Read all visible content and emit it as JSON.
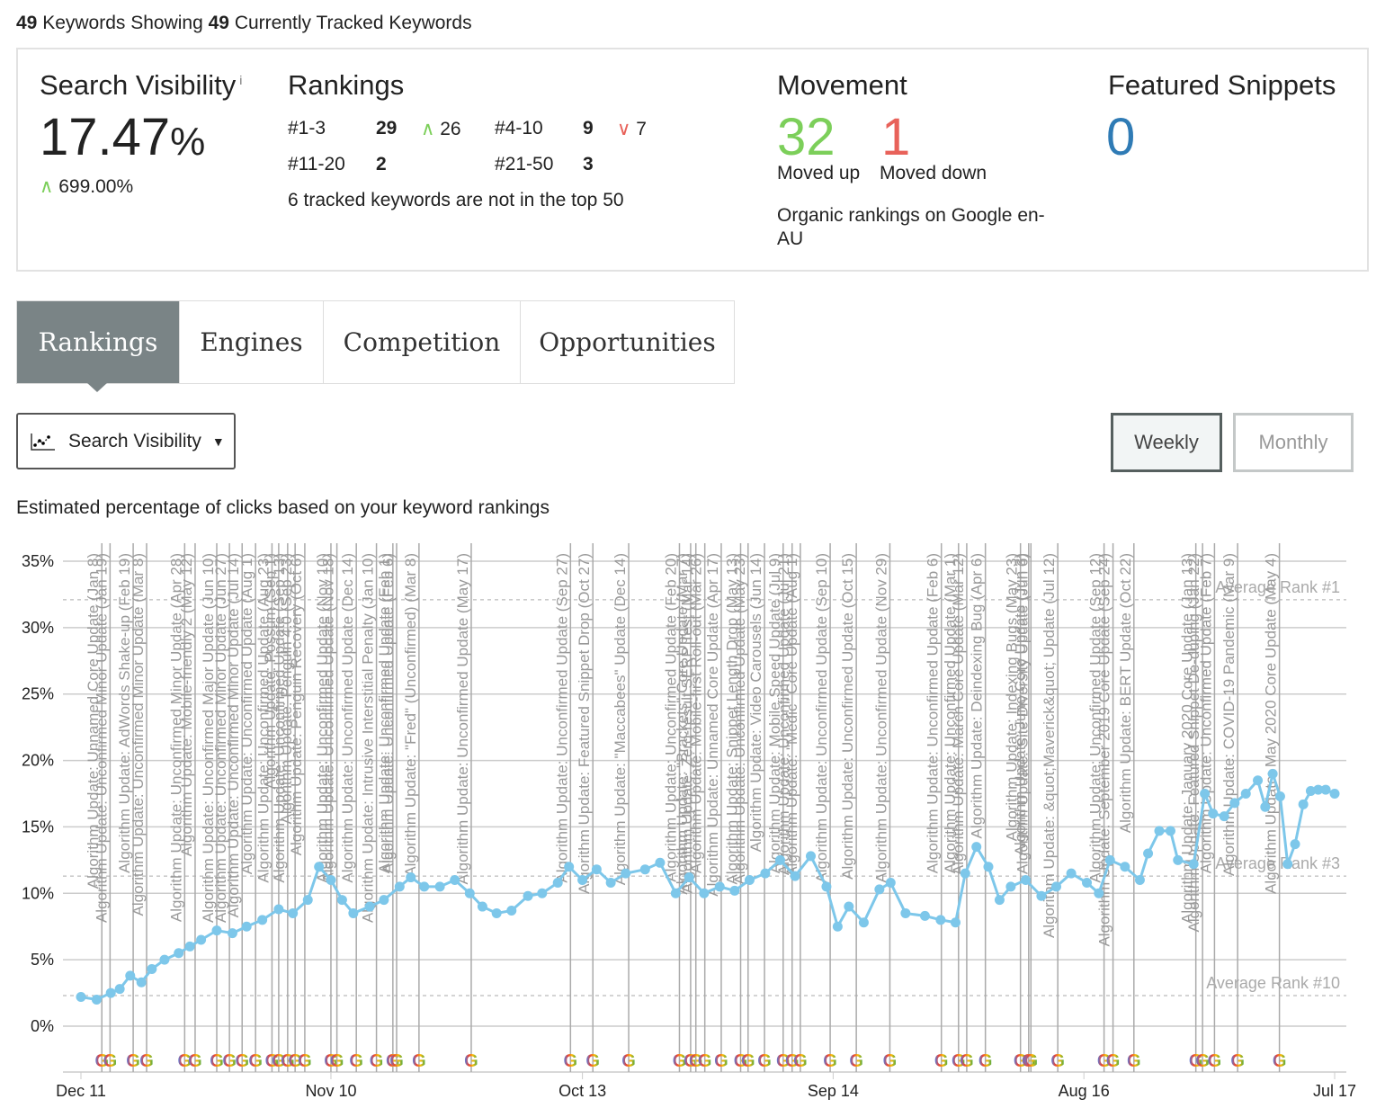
{
  "header": {
    "count1": "49",
    "text1": " Keywords Showing ",
    "count2": "49",
    "text2": " Currently Tracked Keywords"
  },
  "summary": {
    "visibility": {
      "title": "Search Visibility",
      "info": "i",
      "value": "17.47",
      "unit": "%",
      "change": "699.00%"
    },
    "rankings": {
      "title": "Rankings",
      "rows": [
        {
          "label": "#1-3",
          "count": "29",
          "change": "26",
          "direction": "up"
        },
        {
          "label": "#4-10",
          "count": "9",
          "change": "7",
          "direction": "down"
        },
        {
          "label": "#11-20",
          "count": "2"
        },
        {
          "label": "#21-50",
          "count": "3"
        }
      ],
      "note": "6 tracked keywords are not in the top 50"
    },
    "movement": {
      "title": "Movement",
      "up": "32",
      "up_label": "Moved up",
      "down": "1",
      "down_label": "Moved down",
      "note": "Organic rankings on Google en-AU"
    },
    "snippets": {
      "title": "Featured Snippets",
      "value": "0"
    }
  },
  "tabs": [
    {
      "label": "Rankings",
      "active": true
    },
    {
      "label": "Engines"
    },
    {
      "label": "Competition"
    },
    {
      "label": "Opportunities"
    }
  ],
  "controls": {
    "metric": "Search Visibility",
    "metric_icon": "line-chart-icon",
    "weekly": "Weekly",
    "monthly": "Monthly",
    "selected": "Weekly"
  },
  "subtitle": "Estimated percentage of clicks based on your keyword rankings",
  "colors": {
    "series": "#7dc7ea",
    "up": "#7ccf5a",
    "down": "#e8625a",
    "snippets": "#2f7bb5",
    "active_tab": "#7a8486"
  },
  "chart_data": {
    "type": "line",
    "ylim": [
      0,
      35
    ],
    "yticks": [
      "0%",
      "5%",
      "10%",
      "15%",
      "20%",
      "25%",
      "30%",
      "35%"
    ],
    "xticks": [
      {
        "date": "2015-12-11",
        "label": "Dec 11"
      },
      {
        "date": "2016-11-10",
        "label": "Nov 10"
      },
      {
        "date": "2017-10-13",
        "label": "Oct 13"
      },
      {
        "date": "2018-09-14",
        "label": "Sep 14"
      },
      {
        "date": "2019-08-16",
        "label": "Aug 16"
      },
      {
        "date": "2020-07-17",
        "label": "Jul 17"
      }
    ],
    "xrange": [
      "2015-12-11",
      "2020-07-17"
    ],
    "grid": true,
    "reference_lines": [
      {
        "value": 32.1,
        "label": "Average Rank #1"
      },
      {
        "value": 11.3,
        "label": "Average Rank #3"
      },
      {
        "value": 2.3,
        "label": "Average Rank #10"
      }
    ],
    "series": [
      {
        "points": [
          [
            "2015-12-11",
            2.2
          ],
          [
            "2016-01-01",
            2.0
          ],
          [
            "2016-01-20",
            2.5
          ],
          [
            "2016-02-01",
            2.8
          ],
          [
            "2016-02-15",
            3.8
          ],
          [
            "2016-03-01",
            3.3
          ],
          [
            "2016-03-15",
            4.3
          ],
          [
            "2016-04-01",
            5.0
          ],
          [
            "2016-04-20",
            5.5
          ],
          [
            "2016-05-05",
            6.0
          ],
          [
            "2016-05-20",
            6.5
          ],
          [
            "2016-06-10",
            7.2
          ],
          [
            "2016-07-01",
            7.0
          ],
          [
            "2016-07-20",
            7.5
          ],
          [
            "2016-08-10",
            8.0
          ],
          [
            "2016-09-01",
            8.8
          ],
          [
            "2016-09-20",
            8.5
          ],
          [
            "2016-10-10",
            9.5
          ],
          [
            "2016-10-25",
            12.0
          ],
          [
            "2016-11-10",
            11.0
          ],
          [
            "2016-11-25",
            9.5
          ],
          [
            "2016-12-10",
            8.5
          ],
          [
            "2017-01-01",
            9.0
          ],
          [
            "2017-01-20",
            9.5
          ],
          [
            "2017-02-10",
            10.5
          ],
          [
            "2017-02-25",
            11.2
          ],
          [
            "2017-03-15",
            10.5
          ],
          [
            "2017-04-05",
            10.5
          ],
          [
            "2017-04-25",
            11.0
          ],
          [
            "2017-05-15",
            10.0
          ],
          [
            "2017-06-01",
            9.0
          ],
          [
            "2017-06-20",
            8.5
          ],
          [
            "2017-07-10",
            8.7
          ],
          [
            "2017-08-01",
            9.8
          ],
          [
            "2017-08-20",
            10.0
          ],
          [
            "2017-09-10",
            10.8
          ],
          [
            "2017-09-25",
            12.0
          ],
          [
            "2017-10-13",
            11.0
          ],
          [
            "2017-11-01",
            11.8
          ],
          [
            "2017-11-20",
            10.8
          ],
          [
            "2017-12-10",
            11.5
          ],
          [
            "2018-01-05",
            11.8
          ],
          [
            "2018-01-25",
            12.3
          ],
          [
            "2018-02-15",
            10.0
          ],
          [
            "2018-03-05",
            11.2
          ],
          [
            "2018-03-25",
            10.0
          ],
          [
            "2018-04-15",
            10.5
          ],
          [
            "2018-05-05",
            10.2
          ],
          [
            "2018-05-25",
            11.0
          ],
          [
            "2018-06-15",
            11.5
          ],
          [
            "2018-07-05",
            12.5
          ],
          [
            "2018-07-25",
            11.3
          ],
          [
            "2018-08-15",
            12.8
          ],
          [
            "2018-09-05",
            10.5
          ],
          [
            "2018-09-20",
            7.5
          ],
          [
            "2018-10-05",
            9.0
          ],
          [
            "2018-10-25",
            7.8
          ],
          [
            "2018-11-15",
            10.3
          ],
          [
            "2018-11-30",
            10.8
          ],
          [
            "2018-12-20",
            8.5
          ],
          [
            "2019-01-15",
            8.3
          ],
          [
            "2019-02-05",
            8.0
          ],
          [
            "2019-02-25",
            7.8
          ],
          [
            "2019-03-10",
            11.5
          ],
          [
            "2019-03-25",
            13.5
          ],
          [
            "2019-04-10",
            12.0
          ],
          [
            "2019-04-25",
            9.5
          ],
          [
            "2019-05-10",
            10.5
          ],
          [
            "2019-05-30",
            11.0
          ],
          [
            "2019-06-20",
            9.8
          ],
          [
            "2019-07-10",
            10.5
          ],
          [
            "2019-07-30",
            11.5
          ],
          [
            "2019-08-20",
            10.8
          ],
          [
            "2019-09-05",
            10.0
          ],
          [
            "2019-09-20",
            12.5
          ],
          [
            "2019-10-10",
            12.0
          ],
          [
            "2019-10-30",
            11.0
          ],
          [
            "2019-11-10",
            13.0
          ],
          [
            "2019-11-25",
            14.7
          ],
          [
            "2019-12-10",
            14.7
          ],
          [
            "2019-12-20",
            12.5
          ],
          [
            "2020-01-10",
            12.2
          ],
          [
            "2020-01-25",
            17.5
          ],
          [
            "2020-02-05",
            16.0
          ],
          [
            "2020-02-20",
            15.8
          ],
          [
            "2020-03-05",
            16.8
          ],
          [
            "2020-03-20",
            17.5
          ],
          [
            "2020-04-05",
            18.5
          ],
          [
            "2020-04-15",
            16.5
          ],
          [
            "2020-04-25",
            19.0
          ],
          [
            "2020-05-05",
            17.3
          ],
          [
            "2020-05-15",
            12.2
          ],
          [
            "2020-05-25",
            13.7
          ],
          [
            "2020-06-05",
            16.7
          ],
          [
            "2020-06-15",
            17.7
          ],
          [
            "2020-06-25",
            17.8
          ],
          [
            "2020-07-05",
            17.8
          ],
          [
            "2020-07-17",
            17.5
          ]
        ]
      }
    ],
    "annotations": [
      [
        "2016-01-08",
        "Algorithm Update: Unnamed Core Update (Jan 8)"
      ],
      [
        "2016-01-19",
        "Algorithm Update: Unconfirmed Minor Update (Jan 19)"
      ],
      [
        "2016-02-19",
        "Algorithm Update: AdWords Shake-up (Feb 19)"
      ],
      [
        "2016-03-08",
        "Algorithm Update: Unconfirmed Minor Update (Mar 8)"
      ],
      [
        "2016-04-28",
        "Algorithm Update: Unconfirmed Minor Update (Apr 28)"
      ],
      [
        "2016-05-12",
        "Algorithm Update: Mobile-friendly 2 (May 12)"
      ],
      [
        "2016-06-10",
        "Algorithm Update: Unconfirmed Major Update (Jun 10)"
      ],
      [
        "2016-06-27",
        "Algorithm Update: Unconfirmed Minor Update (Jun 27)"
      ],
      [
        "2016-07-14",
        "Algorithm Update: Unconfirmed Minor Update (Jul 14)"
      ],
      [
        "2016-08-01",
        "Algorithm Update: Unconfirmed Update (Aug 1)"
      ],
      [
        "2016-08-23",
        "Algorithm Update: Unconfirmed Update (Aug 23)"
      ],
      [
        "2016-09-01",
        "Algorithm Update: Possum (Sep 1)"
      ],
      [
        "2016-09-13",
        "Algorithm Update: Unconfirmed Update (Sep 13)"
      ],
      [
        "2016-09-23",
        "Algorithm Update: Penguin 4.0 (Sep 23)"
      ],
      [
        "2016-10-06",
        "Algorithm Update: Penguin Recovery (Oct 6)"
      ],
      [
        "2016-11-10",
        "Algorithm Update: Unconfirmed Update (Nov 10)"
      ],
      [
        "2016-11-18",
        "Algorithm Update: Unconfirmed Update (Nov 18)"
      ],
      [
        "2016-12-14",
        "Algorithm Update: Unconfirmed Update (Dec 14)"
      ],
      [
        "2017-01-10",
        "Algorithm Update: Intrusive Interstitial Penalty (Jan 10)"
      ],
      [
        "2017-02-01",
        "Algorithm Update: Unconfirmed Update (Feb 1)"
      ],
      [
        "2017-02-06",
        "Algorithm Update: Unconfirmed Update (Feb 6)"
      ],
      [
        "2017-03-08",
        "Algorithm Update: \"Fred\" (Unconfirmed) (Mar 8)"
      ],
      [
        "2017-05-17",
        "Algorithm Update: Unconfirmed Update (May 17)"
      ],
      [
        "2017-09-27",
        "Algorithm Update: Unconfirmed Update (Sep 27)"
      ],
      [
        "2017-10-27",
        "Algorithm Update: Featured Snippet Drop (Oct 27)"
      ],
      [
        "2017-12-14",
        "Algorithm Update: \"Maccabees\" Update (Dec 14)"
      ],
      [
        "2018-02-20",
        "Algorithm Update: Unconfirmed Update (Feb 20)"
      ],
      [
        "2018-03-07",
        "Algorithm Update: \"Brackets\" Core Update (Mar 7)"
      ],
      [
        "2018-03-14",
        "Algorithm Update: Zero-result SERP Test (Mar 14)"
      ],
      [
        "2018-03-26",
        "Algorithm Update: Mobile-first Roll-out (Mar 26)"
      ],
      [
        "2018-04-17",
        "Algorithm Update: Unnamed Core Update (Apr 17)"
      ],
      [
        "2018-05-13",
        "Algorithm Update: Snippet Length Drop (May 13)"
      ],
      [
        "2018-05-23",
        "Algorithm Update: Unconfirmed Update (May 23)"
      ],
      [
        "2018-06-14",
        "Algorithm Update: Video Carousels (Jun 14)"
      ],
      [
        "2018-07-09",
        "Algorithm Update: Mobile Speed Update (Jul 9)"
      ],
      [
        "2018-07-21",
        "Algorithm Update: Unconfirmed Update (Jul 21)"
      ],
      [
        "2018-08-01",
        "Algorithm Update: \"Medic\" Core Update (Aug 1)"
      ],
      [
        "2018-09-10",
        "Algorithm Update: Unconfirmed Update (Sep 10)"
      ],
      [
        "2018-10-15",
        "Algorithm Update: Unconfirmed Update (Oct 15)"
      ],
      [
        "2018-11-29",
        "Algorithm Update: Unconfirmed Update (Nov 29)"
      ],
      [
        "2019-02-06",
        "Algorithm Update: Unconfirmed Update (Feb 6)"
      ],
      [
        "2019-03-01",
        "Algorithm Update: Unconfirmed Update (Mar 1)"
      ],
      [
        "2019-03-12",
        "Algorithm Update: March Core Update (Mar 12)"
      ],
      [
        "2019-04-06",
        "Algorithm Update: Deindexing Bug (Apr 6)"
      ],
      [
        "2019-05-23",
        "Algorithm Update: Indexing Bugs (May 23)"
      ],
      [
        "2019-06-03",
        "Algorithm Update: June Core Update (Jun 3)"
      ],
      [
        "2019-06-06",
        "Algorithm Update: Site Diversity Update (Jun 6)"
      ],
      [
        "2019-07-12",
        "Algorithm Update: &quot;Maverick&quot; Update (Jul 12)"
      ],
      [
        "2019-09-12",
        "Algorithm Update: Unconfirmed Update (Sep 12)"
      ],
      [
        "2019-09-24",
        "Algorithm Update: September 2019 Core Update (Sep 24)"
      ],
      [
        "2019-10-22",
        "Algorithm Update: BERT Update (Oct 22)"
      ],
      [
        "2020-01-13",
        "Algorithm Update: January 2020 Core Update (Jan 13)"
      ],
      [
        "2020-01-22",
        "Algorithm Update: Featured Snippet De-duping (Jan 22)"
      ],
      [
        "2020-02-07",
        "Algorithm Update: Unconfirmed Update (Feb 7)"
      ],
      [
        "2020-03-09",
        "Algorithm Update: COVID-19 Pandemic (Mar 9)"
      ],
      [
        "2020-05-04",
        "Algorithm Update: May 2020 Core Update (May 4)"
      ]
    ]
  }
}
